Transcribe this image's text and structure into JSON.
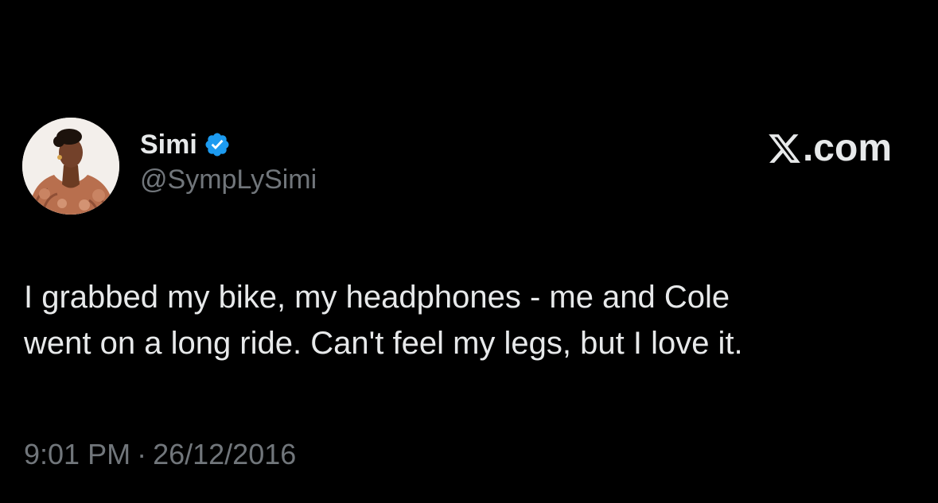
{
  "colors": {
    "background": "#000000",
    "primary_text": "#e7e9ea",
    "secondary_text": "#71767b",
    "verified_badge": "#1d9bf0"
  },
  "author": {
    "display_name": "Simi",
    "handle": "@SympLySimi",
    "verified": true,
    "avatar_icon": "profile-photo-icon"
  },
  "site": {
    "logo_icon": "x-logo-icon",
    "domain_suffix": ".com"
  },
  "tweet": {
    "lines": [
      "I grabbed my bike, my headphones - me and Cole",
      "went on a long ride. Can't feel my legs, but I love it."
    ],
    "time": "9:01 PM",
    "separator": "·",
    "date": "26/12/2016"
  }
}
